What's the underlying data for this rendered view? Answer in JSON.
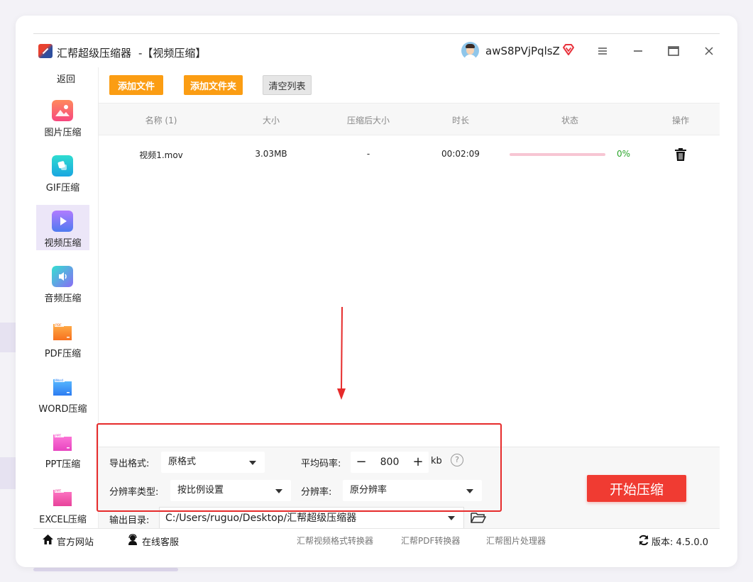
{
  "app": {
    "title": "汇帮超级压缩器",
    "subtitle": "-【视频压缩】",
    "username": "awS8PVjPqlsZ"
  },
  "sidebar": {
    "back": "返回",
    "items": [
      {
        "label": "图片压缩",
        "icon": "image-icon"
      },
      {
        "label": "GIF压缩",
        "icon": "gif-icon"
      },
      {
        "label": "视频压缩",
        "icon": "video-icon",
        "active": true
      },
      {
        "label": "音频压缩",
        "icon": "audio-icon"
      },
      {
        "label": "PDF压缩",
        "icon": "pdf-icon"
      },
      {
        "label": "WORD压缩",
        "icon": "word-icon"
      },
      {
        "label": "PPT压缩",
        "icon": "ppt-icon"
      },
      {
        "label": "EXCEL压缩",
        "icon": "excel-icon"
      }
    ]
  },
  "toolbar": {
    "add_file": "添加文件",
    "add_folder": "添加文件夹",
    "clear_list": "清空列表"
  },
  "table": {
    "headers": [
      "名称 (1)",
      "大小",
      "压缩后大小",
      "时长",
      "状态",
      "操作"
    ],
    "rows": [
      {
        "name": "视频1.mov",
        "size": "3.03MB",
        "compressed": "-",
        "duration": "00:02:09",
        "progress": 0,
        "status": "0%"
      }
    ]
  },
  "settings": {
    "format_label": "导出格式:",
    "format_value": "原格式",
    "bitrate_label": "平均码率:",
    "bitrate_minus": "−",
    "bitrate_value": "800",
    "bitrate_plus": "+",
    "bitrate_unit": "kb",
    "help": "?",
    "res_type_label": "分辨率类型:",
    "res_type_value": "按比例设置",
    "res_label": "分辨率:",
    "res_value": "原分辨率",
    "output_label": "输出目录:",
    "output_path": "C:/Users/ruguo/Desktop/汇帮超级压缩器",
    "start": "开始压缩"
  },
  "footer": {
    "website": "官方网站",
    "service": "在线客服",
    "tool1": "汇帮视频格式转换器",
    "tool2": "汇帮PDF转换器",
    "tool3": "汇帮图片处理器",
    "version": "版本: 4.5.0.0"
  },
  "colors": {
    "accent_orange": "#fb9d13",
    "start_red": "#f03b32",
    "annotation_red": "#e62b2b",
    "success_green": "#2aa52a"
  }
}
